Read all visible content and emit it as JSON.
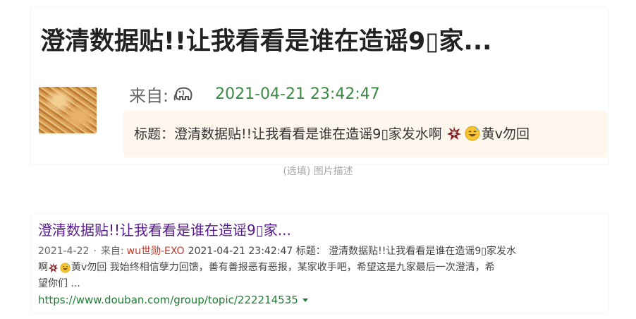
{
  "post": {
    "title": "澄清数据贴!!让我看看是谁在造谣9▯家...",
    "from_label": "来自:",
    "author_icon": "elephant-icon",
    "date": "2021-04-21 23:42:47",
    "title_box": {
      "prefix": "标题：澄清数据贴!!让我看看是谁在造谣9▯家发水啊",
      "suffix": "黄v勿回"
    }
  },
  "caption": "(选填) 图片描述",
  "search_result": {
    "title": "澄清数据贴!!让我看看是谁在造谣9▯家...",
    "date": "2021-4-22",
    "separator": "·",
    "from_label": "来自:",
    "author": "wu世勋-EXO",
    "line1_rest": "2021-04-21 23:42:47 标题： 澄清数据贴!!让我看看是谁在造谣9▯家发水",
    "line2_start": "啊",
    "line2_rest": "黄v勿回 我始终相信孽力回馈，善有善报恶有恶报，某家收手吧，希望这是九家最后一次澄清，希",
    "line3": "望你们 ...",
    "url": "https://www.douban.com/group/topic/222214535"
  },
  "colors": {
    "date_green": "#3c8a45",
    "result_title": "#551a8b",
    "author_red": "#c0392b",
    "url_green": "#1e7e34",
    "title_box_bg": "#fff6ee"
  }
}
